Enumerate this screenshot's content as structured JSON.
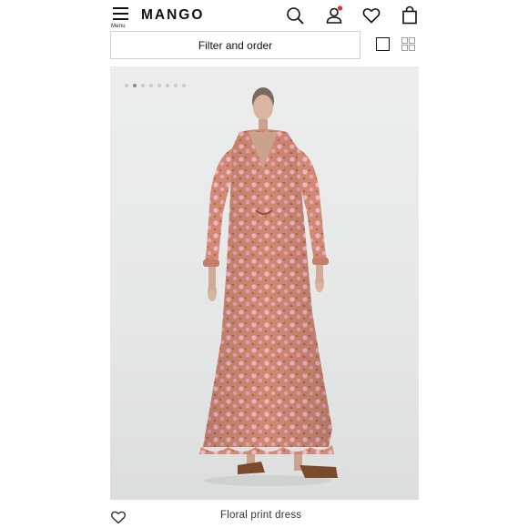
{
  "header": {
    "menu_label": "Menu",
    "logo_text": "MANGO",
    "icons": [
      "menu-icon",
      "search-icon",
      "user-icon",
      "heart-icon",
      "shopping-bag-icon"
    ],
    "notification_color": "#e0322c"
  },
  "toolbar": {
    "filter_label": "Filter and order",
    "view_options": [
      "single-view-icon",
      "grid-view-icon"
    ]
  },
  "product": {
    "name": "Floral print dress",
    "image_count": 8,
    "active_image_index": 1,
    "colors": {
      "dress": "#d4917c",
      "pattern": "#f1b4c4",
      "background": "#e8e9e9"
    }
  }
}
